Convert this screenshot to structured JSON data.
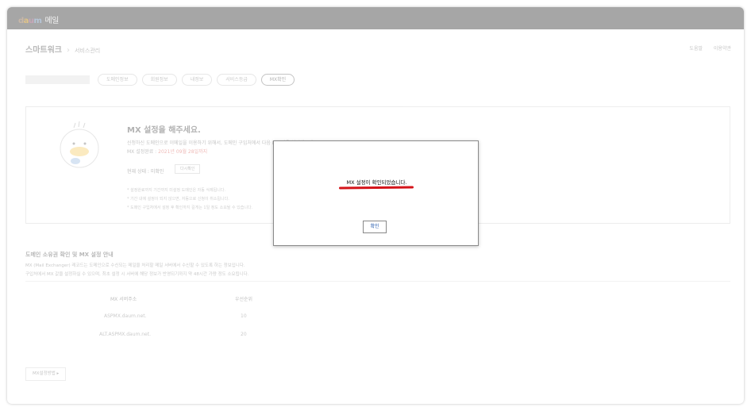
{
  "app": {
    "logo_parts": [
      "d",
      "a",
      "u",
      "m"
    ],
    "logo_suffix": "메일"
  },
  "header": {
    "title": "스마트워크",
    "sub": "서비스관리",
    "links": [
      "도움말",
      "이용약관"
    ]
  },
  "tabs": [
    "도메인정보",
    "회원정보",
    "내정보",
    "서비스등급",
    "MX확인"
  ],
  "card": {
    "title": "MX 설정을 해주세요.",
    "line1": "신청하신 도메인으로 이메일을 이용하기 위해서, 도메인 구입처에서 다음 MX 값을 설정해주세요.",
    "line2_prefix": "MX 설정완료 :",
    "line2_date": "2021년 09월 28일까지",
    "status": "현재 상태 : 미확인",
    "status_button": "다시확인",
    "notes": [
      "* 설정완료까지 기간까지 미설정 도메인은 자동 삭제됩니다.",
      "* 기간 내에 설정이 되지 않으면, 자동으로 신청이 취소됩니다.",
      "* 도메인 구입처에서 설정 후 확인까지 길게는 1일 정도 소요될 수 있습니다."
    ]
  },
  "info": {
    "title": "도메인 소유권 확인 및 MX 설정 안내",
    "line1": "MX (Mail Exchanger) 레코드는 도메인으로 수신되는 메일을 처리할 메일 서버에서 수신할 수 있도록 하는 정보입니다.",
    "line2": "구입처에서 MX 값을 설정하실 수 있으며, 최초 설정 시 서버에 해당 정보가 반영되기까지 약 48시간 가량 정도 소요됩니다."
  },
  "table": {
    "headers": [
      "MX 서버주소",
      "우선순위"
    ],
    "rows": [
      {
        "server": "ASPMX.daum.net.",
        "priority": "10"
      },
      {
        "server": "ALT.ASPMX.daum.net.",
        "priority": "20"
      }
    ]
  },
  "bottom_button": "MX설정방법 ▸",
  "modal": {
    "message": "MX 설정이 확인되었습니다.",
    "ok_label": "확인"
  }
}
